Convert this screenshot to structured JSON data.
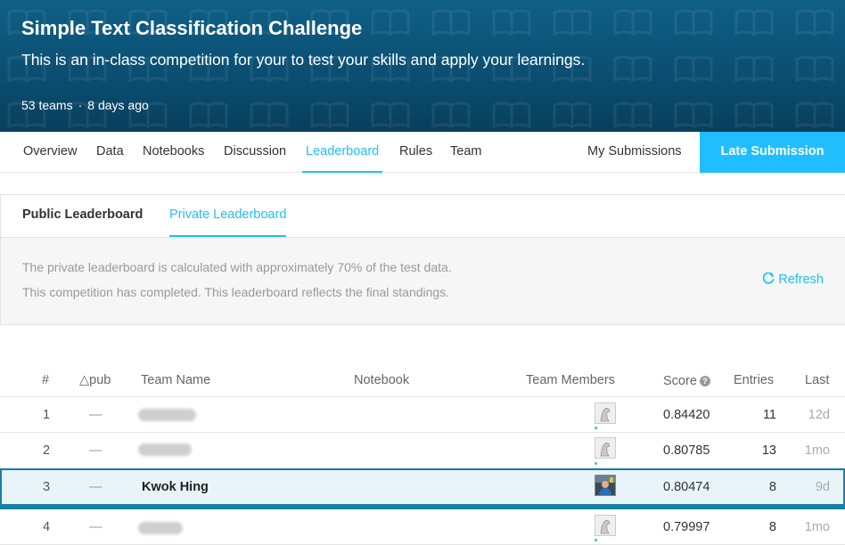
{
  "header": {
    "title": "Simple Text Classification Challenge",
    "subtitle": "This is an in-class competition for your to test your skills and apply your learnings.",
    "teams": "53 teams",
    "separator": "·",
    "age": "8 days ago"
  },
  "nav": {
    "tabs": [
      {
        "label": "Overview"
      },
      {
        "label": "Data"
      },
      {
        "label": "Notebooks"
      },
      {
        "label": "Discussion"
      },
      {
        "label": "Leaderboard",
        "active": true
      },
      {
        "label": "Rules"
      },
      {
        "label": "Team"
      }
    ],
    "my_submissions": "My Submissions",
    "late_submission": "Late Submission"
  },
  "leaderboard": {
    "tabs": {
      "public": "Public Leaderboard",
      "private": "Private Leaderboard"
    },
    "info_line1": "The private leaderboard is calculated with approximately 70% of the test data.",
    "info_line2": "This competition has completed. This leaderboard reflects the final standings.",
    "refresh_label": "Refresh",
    "columns": {
      "rank": "#",
      "delta": "△pub",
      "team_name": "Team Name",
      "notebook": "Notebook",
      "team_members": "Team Members",
      "score": "Score",
      "entries": "Entries",
      "last": "Last"
    },
    "rows": [
      {
        "rank": "1",
        "delta": "—",
        "team_name": "",
        "name_hidden": true,
        "score": "0.84420",
        "entries": "11",
        "last": "12d"
      },
      {
        "rank": "2",
        "delta": "—",
        "team_name": "",
        "name_hidden": true,
        "score": "0.80785",
        "entries": "13",
        "last": "1mo"
      },
      {
        "rank": "3",
        "delta": "—",
        "team_name": "Kwok Hing",
        "name_hidden": false,
        "highlighted": true,
        "score": "0.80474",
        "entries": "8",
        "last": "9d"
      },
      {
        "rank": "4",
        "delta": "—",
        "team_name": "",
        "name_hidden": true,
        "score": "0.79997",
        "entries": "8",
        "last": "1mo"
      }
    ]
  },
  "colors": {
    "accent": "#20beff",
    "banner": "#0b4f72",
    "highlight_border": "#1a7fa3",
    "highlight_bg": "#e8f4f8"
  },
  "icons": {
    "refresh": "refresh-icon",
    "help": "help-icon",
    "avatar": "avatar-icon"
  }
}
